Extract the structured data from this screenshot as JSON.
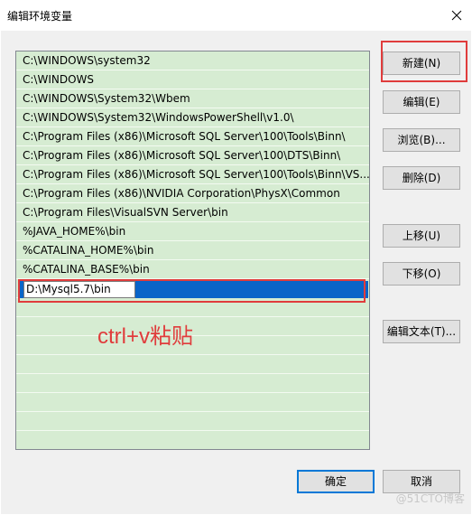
{
  "window": {
    "title": "编辑环境变量"
  },
  "path_list": {
    "items": [
      "C:\\WINDOWS\\system32",
      "C:\\WINDOWS",
      "C:\\WINDOWS\\System32\\Wbem",
      "C:\\WINDOWS\\System32\\WindowsPowerShell\\v1.0\\",
      "C:\\Program Files (x86)\\Microsoft SQL Server\\100\\Tools\\Binn\\",
      "C:\\Program Files (x86)\\Microsoft SQL Server\\100\\DTS\\Binn\\",
      "C:\\Program Files (x86)\\Microsoft SQL Server\\100\\Tools\\Binn\\VS...",
      "C:\\Program Files (x86)\\NVIDIA Corporation\\PhysX\\Common",
      "C:\\Program Files\\VisualSVN Server\\bin",
      "%JAVA_HOME%\\bin",
      "%CATALINA_HOME%\\bin",
      "%CATALINA_BASE%\\bin"
    ],
    "editing_value": "D:\\Mysql5.7\\bin"
  },
  "buttons": {
    "new": "新建(N)",
    "edit": "编辑(E)",
    "browse": "浏览(B)...",
    "delete": "删除(D)",
    "move_up": "上移(U)",
    "move_down": "下移(O)",
    "edit_text": "编辑文本(T)...",
    "ok": "确定",
    "cancel": "取消"
  },
  "annotation": {
    "text": "ctrl+v粘贴"
  },
  "watermark": "@51CTO博客",
  "colors": {
    "list_background": "#d6ecd2",
    "selection": "#0a64c8",
    "annotation_red": "#e03c3c",
    "button_face": "#e1e1e1",
    "default_button_border": "#0078d7"
  }
}
